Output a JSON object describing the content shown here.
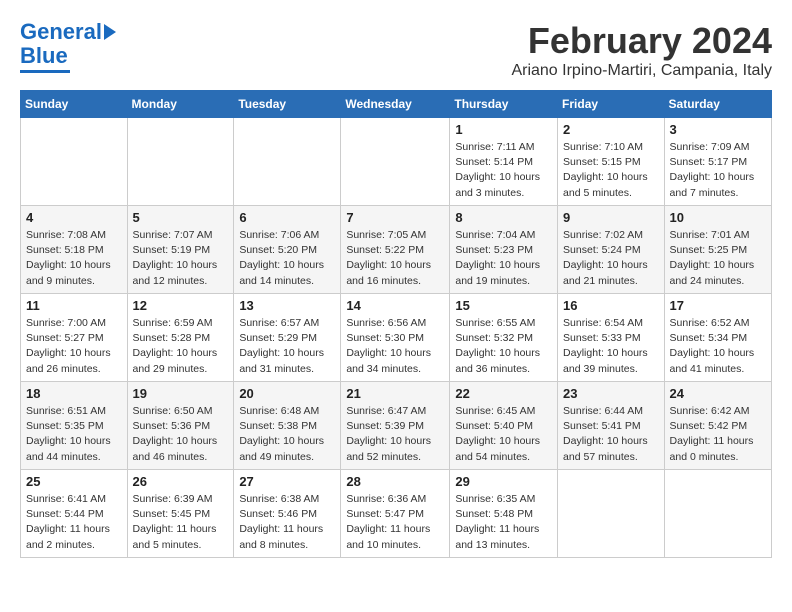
{
  "header": {
    "logo_line1": "General",
    "logo_line2": "Blue",
    "month": "February 2024",
    "location": "Ariano Irpino-Martiri, Campania, Italy"
  },
  "days_of_week": [
    "Sunday",
    "Monday",
    "Tuesday",
    "Wednesday",
    "Thursday",
    "Friday",
    "Saturday"
  ],
  "weeks": [
    [
      {
        "day": "",
        "info": ""
      },
      {
        "day": "",
        "info": ""
      },
      {
        "day": "",
        "info": ""
      },
      {
        "day": "",
        "info": ""
      },
      {
        "day": "1",
        "info": "Sunrise: 7:11 AM\nSunset: 5:14 PM\nDaylight: 10 hours\nand 3 minutes."
      },
      {
        "day": "2",
        "info": "Sunrise: 7:10 AM\nSunset: 5:15 PM\nDaylight: 10 hours\nand 5 minutes."
      },
      {
        "day": "3",
        "info": "Sunrise: 7:09 AM\nSunset: 5:17 PM\nDaylight: 10 hours\nand 7 minutes."
      }
    ],
    [
      {
        "day": "4",
        "info": "Sunrise: 7:08 AM\nSunset: 5:18 PM\nDaylight: 10 hours\nand 9 minutes."
      },
      {
        "day": "5",
        "info": "Sunrise: 7:07 AM\nSunset: 5:19 PM\nDaylight: 10 hours\nand 12 minutes."
      },
      {
        "day": "6",
        "info": "Sunrise: 7:06 AM\nSunset: 5:20 PM\nDaylight: 10 hours\nand 14 minutes."
      },
      {
        "day": "7",
        "info": "Sunrise: 7:05 AM\nSunset: 5:22 PM\nDaylight: 10 hours\nand 16 minutes."
      },
      {
        "day": "8",
        "info": "Sunrise: 7:04 AM\nSunset: 5:23 PM\nDaylight: 10 hours\nand 19 minutes."
      },
      {
        "day": "9",
        "info": "Sunrise: 7:02 AM\nSunset: 5:24 PM\nDaylight: 10 hours\nand 21 minutes."
      },
      {
        "day": "10",
        "info": "Sunrise: 7:01 AM\nSunset: 5:25 PM\nDaylight: 10 hours\nand 24 minutes."
      }
    ],
    [
      {
        "day": "11",
        "info": "Sunrise: 7:00 AM\nSunset: 5:27 PM\nDaylight: 10 hours\nand 26 minutes."
      },
      {
        "day": "12",
        "info": "Sunrise: 6:59 AM\nSunset: 5:28 PM\nDaylight: 10 hours\nand 29 minutes."
      },
      {
        "day": "13",
        "info": "Sunrise: 6:57 AM\nSunset: 5:29 PM\nDaylight: 10 hours\nand 31 minutes."
      },
      {
        "day": "14",
        "info": "Sunrise: 6:56 AM\nSunset: 5:30 PM\nDaylight: 10 hours\nand 34 minutes."
      },
      {
        "day": "15",
        "info": "Sunrise: 6:55 AM\nSunset: 5:32 PM\nDaylight: 10 hours\nand 36 minutes."
      },
      {
        "day": "16",
        "info": "Sunrise: 6:54 AM\nSunset: 5:33 PM\nDaylight: 10 hours\nand 39 minutes."
      },
      {
        "day": "17",
        "info": "Sunrise: 6:52 AM\nSunset: 5:34 PM\nDaylight: 10 hours\nand 41 minutes."
      }
    ],
    [
      {
        "day": "18",
        "info": "Sunrise: 6:51 AM\nSunset: 5:35 PM\nDaylight: 10 hours\nand 44 minutes."
      },
      {
        "day": "19",
        "info": "Sunrise: 6:50 AM\nSunset: 5:36 PM\nDaylight: 10 hours\nand 46 minutes."
      },
      {
        "day": "20",
        "info": "Sunrise: 6:48 AM\nSunset: 5:38 PM\nDaylight: 10 hours\nand 49 minutes."
      },
      {
        "day": "21",
        "info": "Sunrise: 6:47 AM\nSunset: 5:39 PM\nDaylight: 10 hours\nand 52 minutes."
      },
      {
        "day": "22",
        "info": "Sunrise: 6:45 AM\nSunset: 5:40 PM\nDaylight: 10 hours\nand 54 minutes."
      },
      {
        "day": "23",
        "info": "Sunrise: 6:44 AM\nSunset: 5:41 PM\nDaylight: 10 hours\nand 57 minutes."
      },
      {
        "day": "24",
        "info": "Sunrise: 6:42 AM\nSunset: 5:42 PM\nDaylight: 11 hours\nand 0 minutes."
      }
    ],
    [
      {
        "day": "25",
        "info": "Sunrise: 6:41 AM\nSunset: 5:44 PM\nDaylight: 11 hours\nand 2 minutes."
      },
      {
        "day": "26",
        "info": "Sunrise: 6:39 AM\nSunset: 5:45 PM\nDaylight: 11 hours\nand 5 minutes."
      },
      {
        "day": "27",
        "info": "Sunrise: 6:38 AM\nSunset: 5:46 PM\nDaylight: 11 hours\nand 8 minutes."
      },
      {
        "day": "28",
        "info": "Sunrise: 6:36 AM\nSunset: 5:47 PM\nDaylight: 11 hours\nand 10 minutes."
      },
      {
        "day": "29",
        "info": "Sunrise: 6:35 AM\nSunset: 5:48 PM\nDaylight: 11 hours\nand 13 minutes."
      },
      {
        "day": "",
        "info": ""
      },
      {
        "day": "",
        "info": ""
      }
    ]
  ]
}
